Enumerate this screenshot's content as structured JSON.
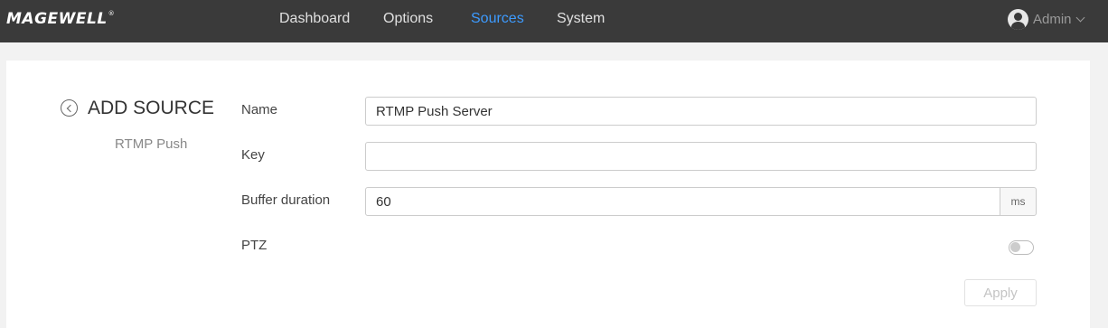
{
  "header": {
    "logo_text": "MAGEWELL",
    "logo_mark": "®",
    "nav": [
      {
        "label": "Dashboard",
        "active": false
      },
      {
        "label": "Options",
        "active": false
      },
      {
        "label": "Sources",
        "active": true
      },
      {
        "label": "System",
        "active": false
      }
    ],
    "user": {
      "name": "Admin",
      "icon": "user-avatar-icon"
    }
  },
  "page": {
    "title": "ADD SOURCE",
    "subtitle": "RTMP Push",
    "back_icon": "back-arrow-icon"
  },
  "form": {
    "name": {
      "label": "Name",
      "value": "RTMP Push Server"
    },
    "key": {
      "label": "Key",
      "value": ""
    },
    "buffer": {
      "label": "Buffer duration",
      "value": "60",
      "unit": "ms"
    },
    "ptz": {
      "label": "PTZ",
      "enabled": false
    },
    "apply_label": "Apply"
  },
  "colors": {
    "topbar": "#3a3a3a",
    "accent": "#3d9bff"
  }
}
